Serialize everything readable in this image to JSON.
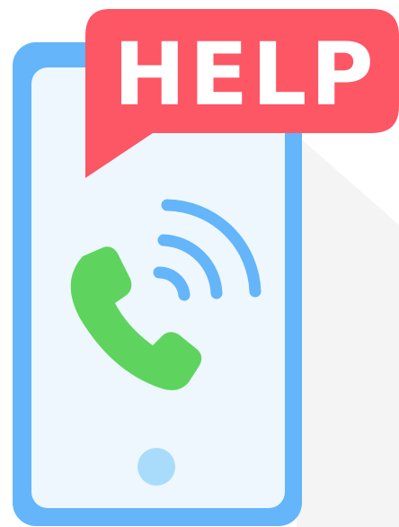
{
  "bubble": {
    "text": "HELP"
  },
  "colors": {
    "background": "#ffffff",
    "shadow": "#f3f3f3",
    "phone_frame": "#64b5f9",
    "phone_screen": "#eef7fd",
    "bubble": "#fd5665",
    "bubble_text": "#ffffff",
    "handset": "#5ed45e",
    "signal_waves": "#64b5f9",
    "home_button": "#a9dcfb"
  },
  "icons": {
    "handset": "phone-handset-icon",
    "signal": "signal-waves-icon",
    "home": "home-button-icon"
  }
}
